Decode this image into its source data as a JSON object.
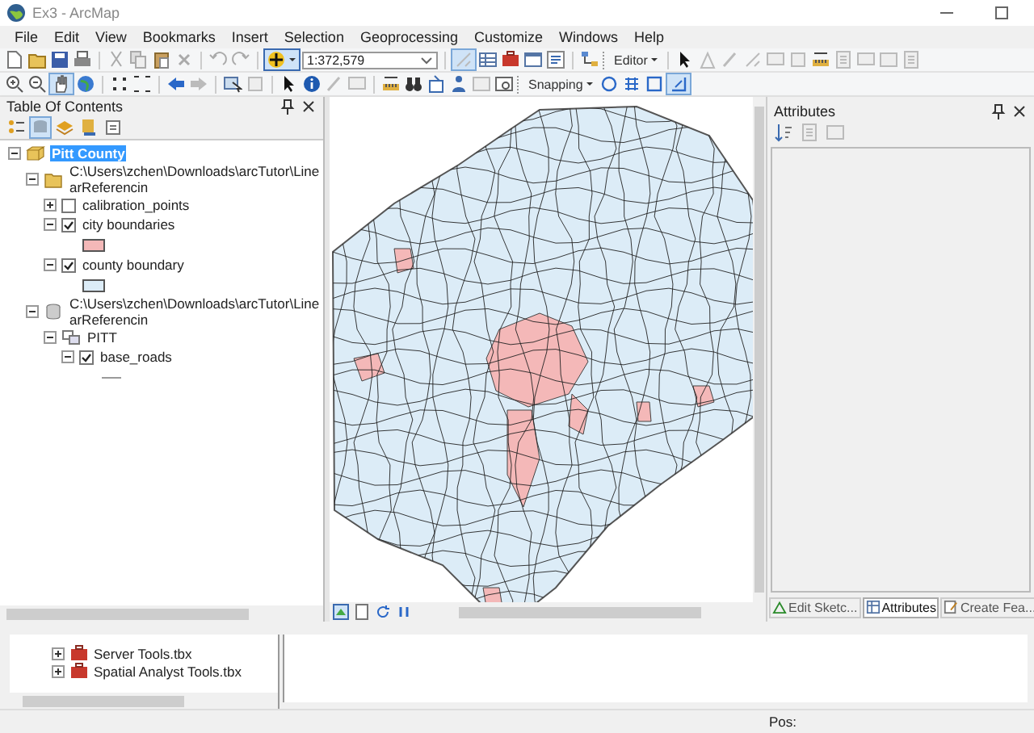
{
  "window": {
    "title": "Ex3 - ArcMap"
  },
  "menu": [
    "File",
    "Edit",
    "View",
    "Bookmarks",
    "Insert",
    "Selection",
    "Geoprocessing",
    "Customize",
    "Windows",
    "Help"
  ],
  "toolbar": {
    "scale": "1:372,579",
    "editor": "Editor",
    "snapping": "Snapping"
  },
  "toc": {
    "title": "Table Of Contents",
    "tree": [
      {
        "label": "Pitt County",
        "kind": "group",
        "expanded": true,
        "selected": true,
        "children": [
          {
            "label": "C:\\Users\\zchen\\Downloads\\arcTutor\\LinearReferencin",
            "kind": "folder",
            "expanded": true,
            "selected": false,
            "children": [
              {
                "label": "calibration_points",
                "kind": "layer",
                "expanded": false,
                "checked": false,
                "selected": false
              },
              {
                "label": "city boundaries",
                "kind": "layer",
                "expanded": true,
                "checked": true,
                "selected": false,
                "legend": {
                  "kind": "fill",
                  "color": "#f4b8b8"
                }
              },
              {
                "label": "county boundary",
                "kind": "layer",
                "expanded": true,
                "checked": true,
                "selected": false,
                "legend": {
                  "kind": "fill",
                  "color": "#dcecf7"
                }
              }
            ]
          },
          {
            "label": "C:\\Users\\zchen\\Downloads\\arcTutor\\LinearReferencin",
            "kind": "database",
            "expanded": true,
            "selected": false,
            "children": [
              {
                "label": "PITT",
                "kind": "dataset",
                "expanded": true,
                "selected": false,
                "children": [
                  {
                    "label": "base_roads",
                    "kind": "layer",
                    "expanded": true,
                    "checked": true,
                    "selected": false,
                    "legend": {
                      "kind": "line",
                      "color": "#9a9a9a"
                    }
                  }
                ]
              }
            ]
          }
        ]
      }
    ]
  },
  "attributes": {
    "title": "Attributes"
  },
  "dock_tabs": [
    {
      "label": "Edit Sketc...",
      "selected": false
    },
    {
      "label": "Attributes",
      "selected": true
    },
    {
      "label": "Create Fea...",
      "selected": false
    }
  ],
  "catalog": [
    {
      "label": "Server Tools.tbx"
    },
    {
      "label": "Spatial Analyst Tools.tbx"
    }
  ],
  "status_bar": {
    "position_label": "Pos:"
  }
}
